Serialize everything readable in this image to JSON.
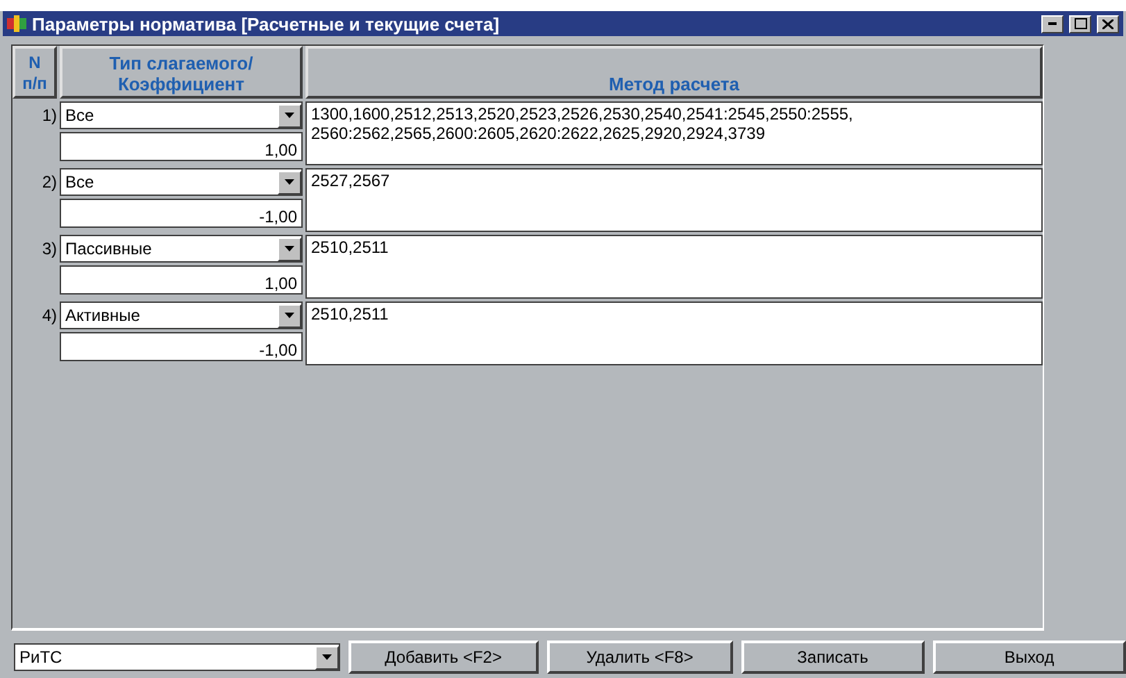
{
  "window": {
    "title": "Параметры норматива [Расчетные и текущие счета]"
  },
  "table": {
    "columns": [
      {
        "label": "N п/п"
      },
      {
        "label": "Тип слагаемого/ Коэффициент"
      },
      {
        "label": "Метод расчета"
      }
    ],
    "rows": [
      {
        "number": "1)",
        "type": "Все",
        "coefficient": "1,00",
        "method": "1300,1600,2512,2513,2520,2523,2526,2530,2540,2541:2545,2550:2555, 2560:2562,2565,2600:2605,2620:2622,2625,2920,2924,3739"
      },
      {
        "number": "2)",
        "type": "Все",
        "coefficient": "-1,00",
        "method": "2527,2567"
      },
      {
        "number": "3)",
        "type": "Пассивные",
        "coefficient": "1,00",
        "method": "2510,2511"
      },
      {
        "number": "4)",
        "type": "Активные",
        "coefficient": "-1,00",
        "method": "2510,2511"
      }
    ]
  },
  "footer": {
    "selector": "РиТС",
    "buttons": [
      "Добавить <F2>",
      "Удалить <F8>",
      "Записать",
      "Выход"
    ]
  }
}
